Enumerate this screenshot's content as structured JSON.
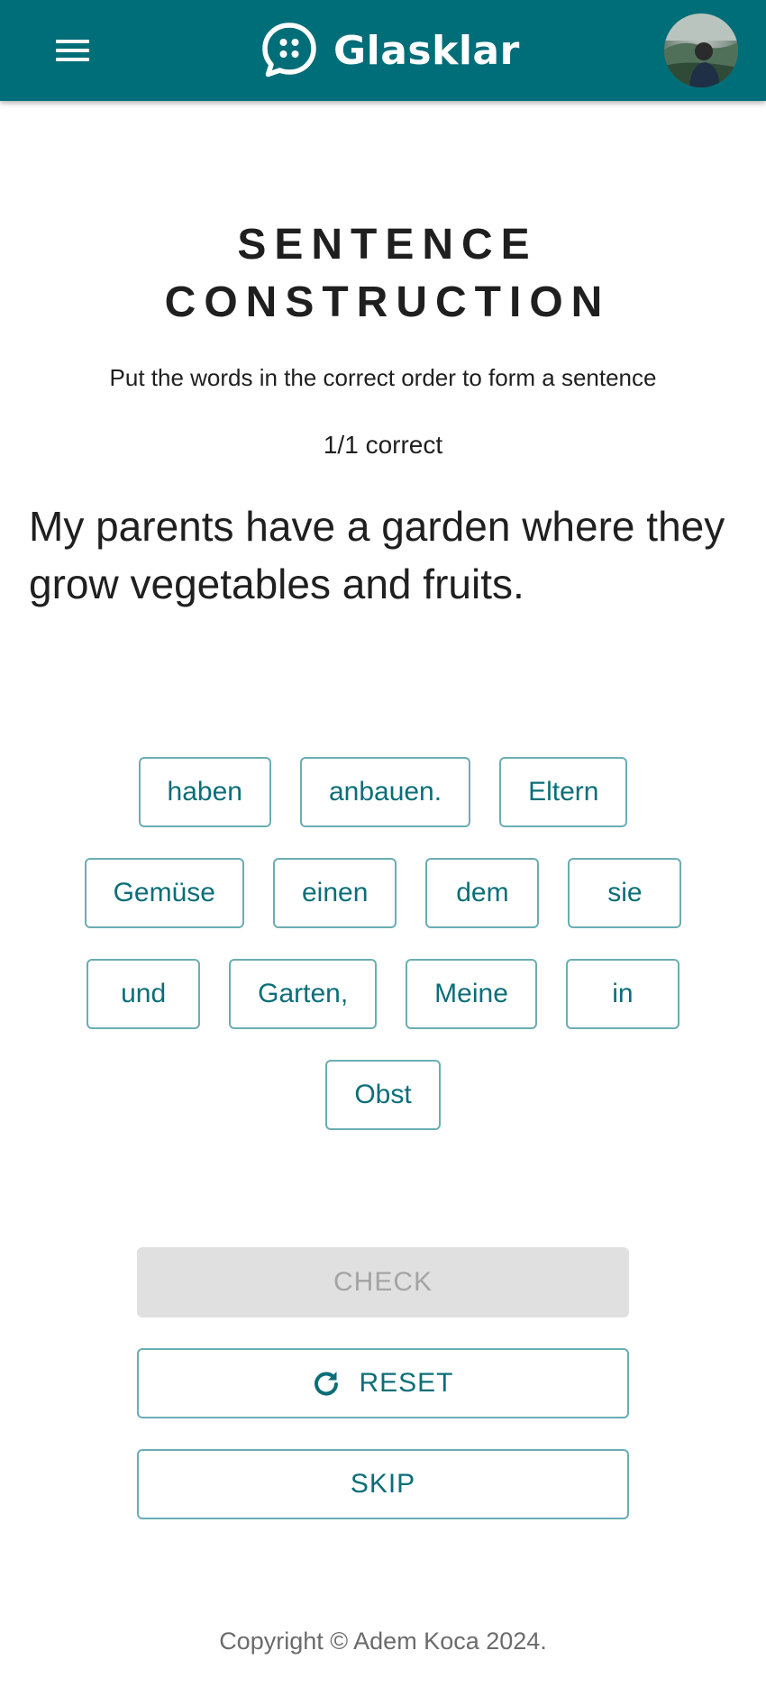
{
  "app": {
    "name": "Glasklar",
    "brand_color": "#006e78",
    "accent_color": "#0b6e78"
  },
  "header": {
    "menu_icon": "hamburger-menu-icon",
    "logo_icon": "chat-bubble-dots-icon",
    "avatar_icon": "user-avatar-photo"
  },
  "exercise": {
    "title": "SENTENCE CONSTRUCTION",
    "instruction": "Put the words in the correct order to form a sentence",
    "progress": "1/1 correct",
    "prompt": "My parents have a garden where they grow vegetables and fruits."
  },
  "word_bank": [
    "haben",
    "anbauen.",
    "Eltern",
    "Gemüse",
    "einen",
    "dem",
    "sie",
    "und",
    "Garten,",
    "Meine",
    "in",
    "Obst"
  ],
  "actions": {
    "check_label": "CHECK",
    "check_disabled": true,
    "reset_label": "RESET",
    "reset_icon": "refresh-icon",
    "skip_label": "SKIP"
  },
  "footer": {
    "copyright": "Copyright © Adem Koca 2024."
  }
}
